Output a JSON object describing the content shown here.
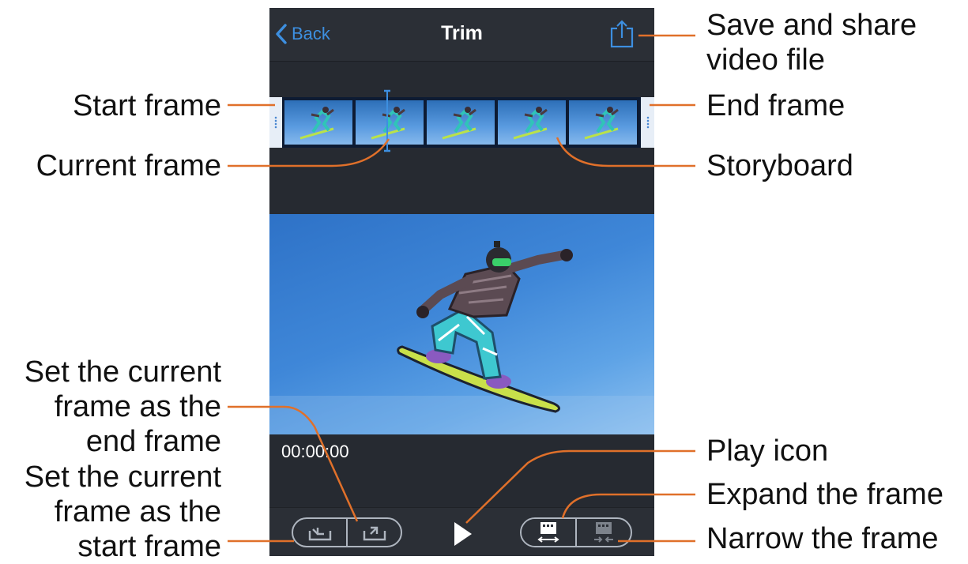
{
  "navbar": {
    "back_label": "Back",
    "title": "Trim"
  },
  "player": {
    "timestamp": "00:00:00"
  },
  "colors": {
    "accent": "#3d8fe0",
    "callout": "#e0702a",
    "background": "#262a31"
  },
  "storyboard": {
    "frame_count": 5
  },
  "callouts": {
    "save_share": "Save and share video file",
    "save_share_line1": "Save and share",
    "save_share_line2": "video file",
    "start_frame": "Start frame",
    "end_frame": "End frame",
    "current_frame": "Current frame",
    "storyboard": "Storyboard",
    "set_end": "Set the current frame as the end frame",
    "set_end_l1": "Set the current",
    "set_end_l2": "frame as the",
    "set_end_l3": "end frame",
    "set_start": "Set the current frame as the start frame",
    "set_start_l1": "Set the current",
    "set_start_l2": "frame as the",
    "set_start_l3": "start frame",
    "play_icon": "Play icon",
    "expand_frame": "Expand the frame",
    "narrow_frame": "Narrow the frame"
  },
  "icons": {
    "back": "chevron-left-icon",
    "share": "share-icon",
    "play": "play-icon",
    "set_start": "set-start-frame-icon",
    "set_end": "set-end-frame-icon",
    "expand": "expand-frame-icon",
    "narrow": "narrow-frame-icon"
  }
}
